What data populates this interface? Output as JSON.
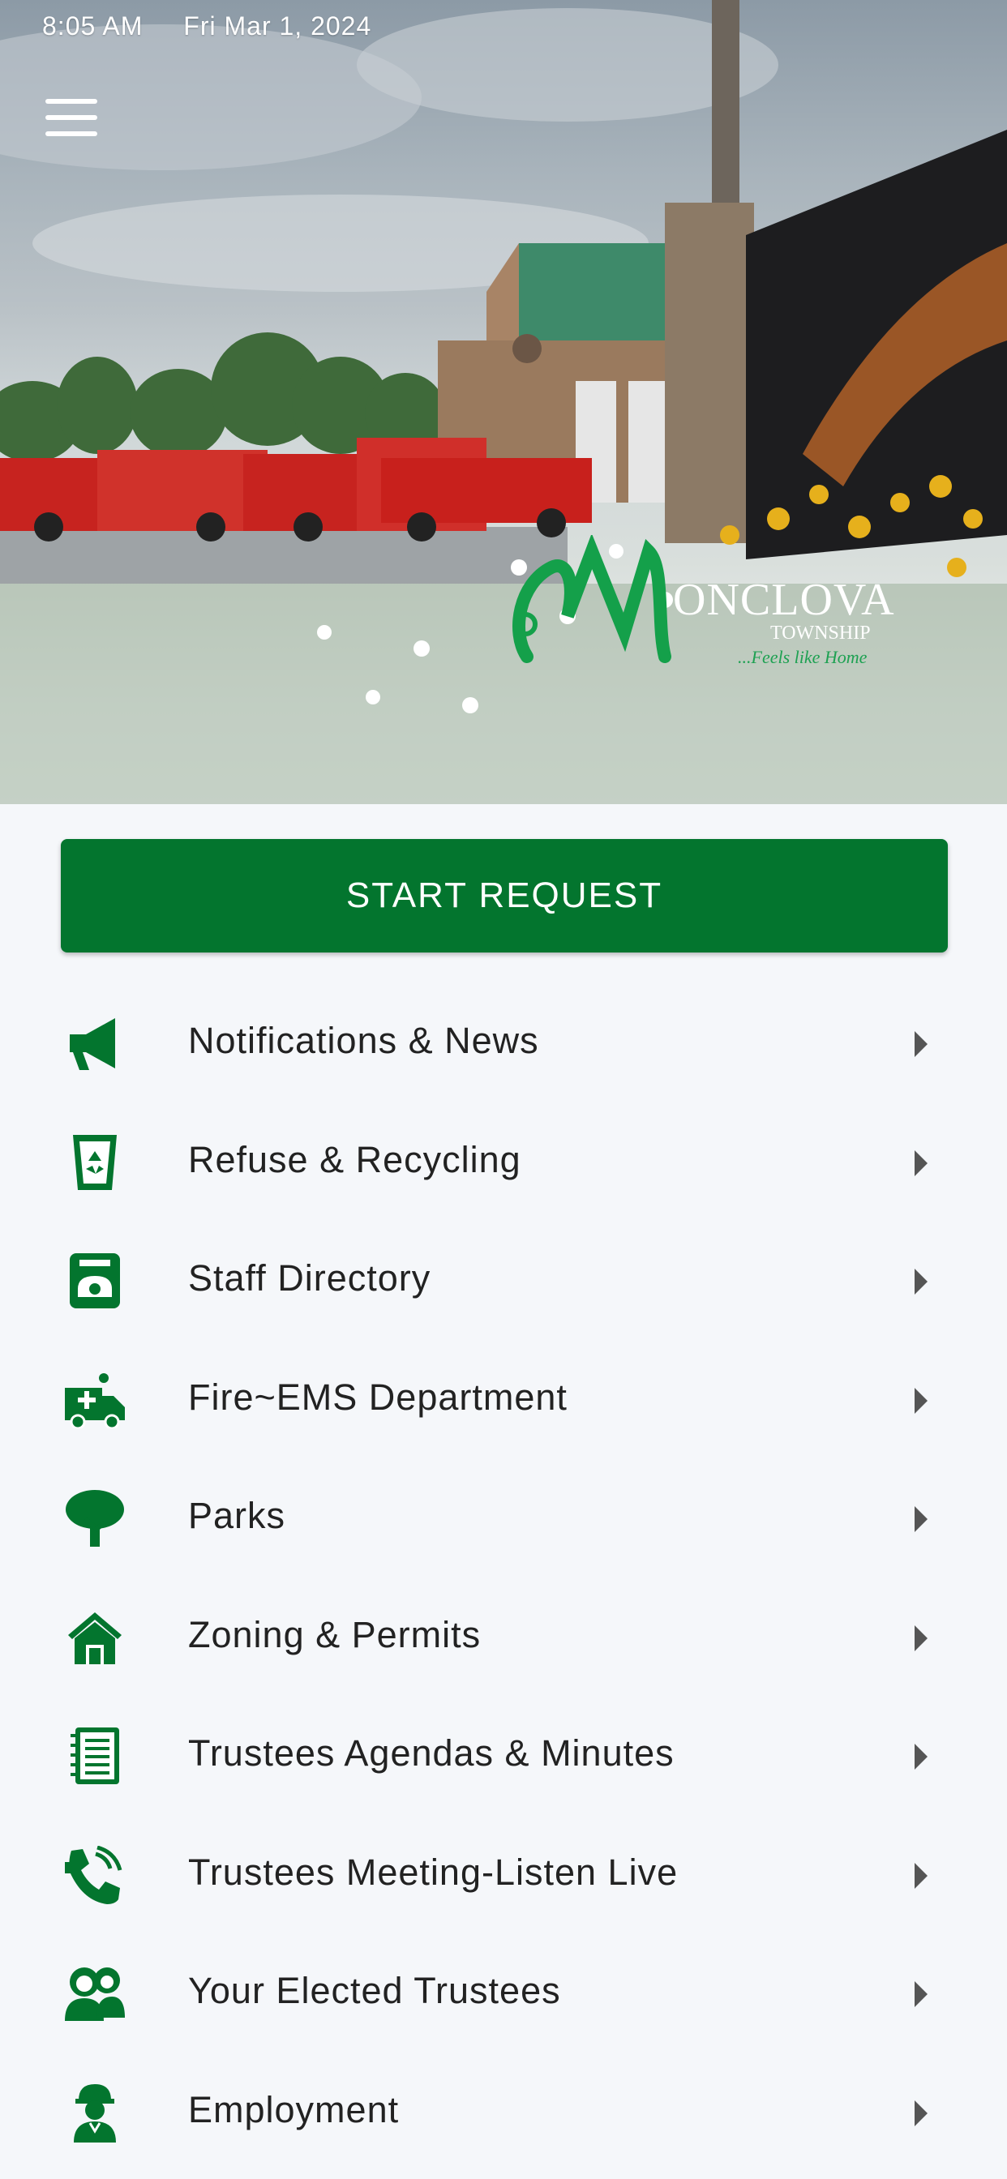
{
  "status_bar": {
    "time": "8:05 AM",
    "date": "Fri Mar 1, 2024"
  },
  "hero": {
    "logo_text": "ONCLOVA",
    "logo_sub": "TOWNSHIP",
    "logo_tag": "...Feels like Home"
  },
  "start_request_label": "START REQUEST",
  "menu_items": [
    {
      "label": "Notifications & News",
      "icon": "megaphone-icon"
    },
    {
      "label": "Refuse & Recycling",
      "icon": "recycle-bin-icon"
    },
    {
      "label": "Staff Directory",
      "icon": "phone-directory-icon"
    },
    {
      "label": "Fire~EMS Department",
      "icon": "ambulance-icon"
    },
    {
      "label": "Parks",
      "icon": "tree-icon"
    },
    {
      "label": "Zoning & Permits",
      "icon": "house-icon"
    },
    {
      "label": "Trustees Agendas & Minutes",
      "icon": "notebook-icon"
    },
    {
      "label": "Trustees Meeting-Listen Live",
      "icon": "phone-audio-icon"
    },
    {
      "label": "Your Elected Trustees",
      "icon": "people-icon"
    },
    {
      "label": "Employment",
      "icon": "worker-icon"
    }
  ],
  "colors": {
    "brand_green": "#03752e",
    "background": "#f5f7fa",
    "text": "#222222"
  }
}
